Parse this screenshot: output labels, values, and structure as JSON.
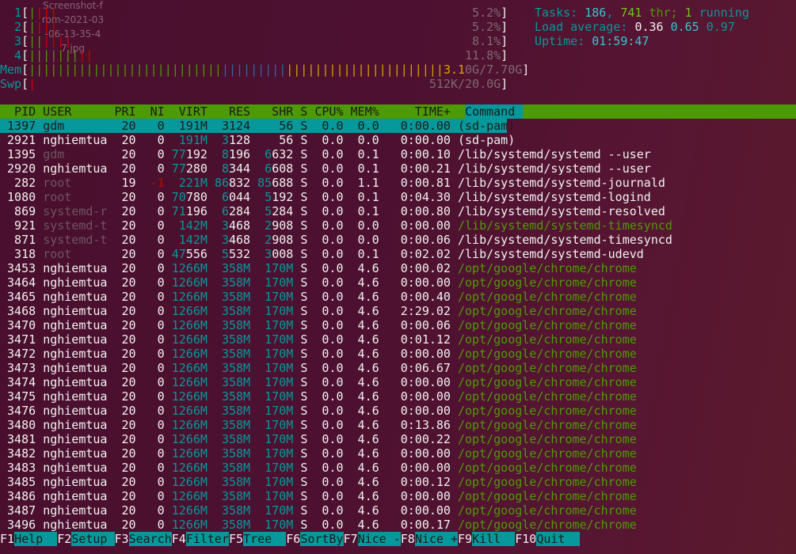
{
  "desktop_icon_label": "Screenshot-from-2021-03-06-13-35-47.jpg",
  "meters": {
    "cpus": [
      {
        "label": "1",
        "percent_text": "5.2%",
        "green_bars": 1,
        "red_bars": 3
      },
      {
        "label": "2",
        "percent_text": "5.2%",
        "green_bars": 1,
        "red_bars": 3
      },
      {
        "label": "3",
        "percent_text": "8.1%",
        "green_bars": 2,
        "red_bars": 4
      },
      {
        "label": "4",
        "percent_text": "11.8%",
        "green_bars": 7,
        "red_bars": 2
      }
    ],
    "mem": {
      "label": "Mem",
      "used_text": "3.1",
      "rest_text": "0G/7.70G",
      "used_bars": 27,
      "buffer_bars": 9,
      "cache_bars": 22
    },
    "swp": {
      "label": "Swp",
      "value_text": "512K/20.0G",
      "used_bars": 1
    }
  },
  "sysinfo": {
    "tasks_label": "Tasks: ",
    "tasks": "186",
    "threads": "741",
    "thr_label": " thr; ",
    "running": "1",
    "running_label": " running",
    "load_label": "Load average: ",
    "load1": "0.36",
    "load5": "0.65",
    "load15": "0.97",
    "uptime_label": "Uptime: ",
    "uptime": "01:59:47"
  },
  "columns": {
    "pid": "PID",
    "user": "USER",
    "pri": "PRI",
    "ni": "NI",
    "virt": "VIRT",
    "res": "RES",
    "shr": "SHR",
    "s": "S",
    "cpu": "CPU%",
    "mem": "MEM%",
    "time": "TIME+",
    "cmd": "Command"
  },
  "processes": [
    {
      "pid": "1397",
      "user": "gdm",
      "pri": "20",
      "ni": "0",
      "virt": "191M",
      "res": "3124",
      "shr": "56",
      "s": "S",
      "cpu": "0.0",
      "mem": "0.0",
      "time": "0:00.00",
      "cmd": "(sd-pam)",
      "selected": true,
      "user_dim": true,
      "thread": false
    },
    {
      "pid": "2921",
      "user": "nghiemtua",
      "pri": "20",
      "ni": "0",
      "virt": "191M",
      "res": "3128",
      "shr": "56",
      "s": "S",
      "cpu": "0.0",
      "mem": "0.0",
      "time": "0:00.00",
      "cmd": "(sd-pam)",
      "selected": false,
      "user_dim": false,
      "thread": false
    },
    {
      "pid": "1395",
      "user": "gdm",
      "pri": "20",
      "ni": "0",
      "virt": "77192",
      "res": "8196",
      "shr": "6632",
      "s": "S",
      "cpu": "0.0",
      "mem": "0.1",
      "time": "0:00.10",
      "cmd": "/lib/systemd/systemd --user",
      "selected": false,
      "user_dim": true,
      "thread": false
    },
    {
      "pid": "2920",
      "user": "nghiemtua",
      "pri": "20",
      "ni": "0",
      "virt": "77280",
      "res": "8344",
      "shr": "6608",
      "s": "S",
      "cpu": "0.0",
      "mem": "0.1",
      "time": "0:00.21",
      "cmd": "/lib/systemd/systemd --user",
      "selected": false,
      "user_dim": false,
      "thread": false
    },
    {
      "pid": "282",
      "user": "root",
      "pri": "19",
      "ni": "-1",
      "virt": "221M",
      "res": "86832",
      "shr": "85688",
      "s": "S",
      "cpu": "0.0",
      "mem": "1.1",
      "time": "0:00.81",
      "cmd": "/lib/systemd/systemd-journald",
      "selected": false,
      "user_dim": true,
      "thread": false
    },
    {
      "pid": "1080",
      "user": "root",
      "pri": "20",
      "ni": "0",
      "virt": "70780",
      "res": "6044",
      "shr": "5192",
      "s": "S",
      "cpu": "0.0",
      "mem": "0.1",
      "time": "0:04.30",
      "cmd": "/lib/systemd/systemd-logind",
      "selected": false,
      "user_dim": true,
      "thread": false
    },
    {
      "pid": "869",
      "user": "systemd-r",
      "pri": "20",
      "ni": "0",
      "virt": "71196",
      "res": "6284",
      "shr": "5284",
      "s": "S",
      "cpu": "0.0",
      "mem": "0.1",
      "time": "0:00.80",
      "cmd": "/lib/systemd/systemd-resolved",
      "selected": false,
      "user_dim": true,
      "thread": false
    },
    {
      "pid": "921",
      "user": "systemd-t",
      "pri": "20",
      "ni": "0",
      "virt": "142M",
      "res": "3468",
      "shr": "2908",
      "s": "S",
      "cpu": "0.0",
      "mem": "0.0",
      "time": "0:00.00",
      "cmd": "/lib/systemd/systemd-timesyncd",
      "selected": false,
      "user_dim": true,
      "thread": true
    },
    {
      "pid": "871",
      "user": "systemd-t",
      "pri": "20",
      "ni": "0",
      "virt": "142M",
      "res": "3468",
      "shr": "2908",
      "s": "S",
      "cpu": "0.0",
      "mem": "0.0",
      "time": "0:00.06",
      "cmd": "/lib/systemd/systemd-timesyncd",
      "selected": false,
      "user_dim": true,
      "thread": false
    },
    {
      "pid": "318",
      "user": "root",
      "pri": "20",
      "ni": "0",
      "virt": "47556",
      "res": "5532",
      "shr": "3008",
      "s": "S",
      "cpu": "0.0",
      "mem": "0.1",
      "time": "0:02.02",
      "cmd": "/lib/systemd/systemd-udevd",
      "selected": false,
      "user_dim": true,
      "thread": false
    },
    {
      "pid": "3453",
      "user": "nghiemtua",
      "pri": "20",
      "ni": "0",
      "virt": "1266M",
      "res": "358M",
      "shr": "170M",
      "s": "S",
      "cpu": "0.0",
      "mem": "4.6",
      "time": "0:00.02",
      "cmd": "/opt/google/chrome/chrome",
      "selected": false,
      "user_dim": false,
      "thread": true
    },
    {
      "pid": "3464",
      "user": "nghiemtua",
      "pri": "20",
      "ni": "0",
      "virt": "1266M",
      "res": "358M",
      "shr": "170M",
      "s": "S",
      "cpu": "0.0",
      "mem": "4.6",
      "time": "0:00.00",
      "cmd": "/opt/google/chrome/chrome",
      "selected": false,
      "user_dim": false,
      "thread": true
    },
    {
      "pid": "3465",
      "user": "nghiemtua",
      "pri": "20",
      "ni": "0",
      "virt": "1266M",
      "res": "358M",
      "shr": "170M",
      "s": "S",
      "cpu": "0.0",
      "mem": "4.6",
      "time": "0:00.40",
      "cmd": "/opt/google/chrome/chrome",
      "selected": false,
      "user_dim": false,
      "thread": true
    },
    {
      "pid": "3468",
      "user": "nghiemtua",
      "pri": "20",
      "ni": "0",
      "virt": "1266M",
      "res": "358M",
      "shr": "170M",
      "s": "S",
      "cpu": "0.0",
      "mem": "4.6",
      "time": "2:29.02",
      "cmd": "/opt/google/chrome/chrome",
      "selected": false,
      "user_dim": false,
      "thread": true
    },
    {
      "pid": "3470",
      "user": "nghiemtua",
      "pri": "20",
      "ni": "0",
      "virt": "1266M",
      "res": "358M",
      "shr": "170M",
      "s": "S",
      "cpu": "0.0",
      "mem": "4.6",
      "time": "0:00.06",
      "cmd": "/opt/google/chrome/chrome",
      "selected": false,
      "user_dim": false,
      "thread": true
    },
    {
      "pid": "3471",
      "user": "nghiemtua",
      "pri": "20",
      "ni": "0",
      "virt": "1266M",
      "res": "358M",
      "shr": "170M",
      "s": "S",
      "cpu": "0.0",
      "mem": "4.6",
      "time": "0:01.12",
      "cmd": "/opt/google/chrome/chrome",
      "selected": false,
      "user_dim": false,
      "thread": true
    },
    {
      "pid": "3472",
      "user": "nghiemtua",
      "pri": "20",
      "ni": "0",
      "virt": "1266M",
      "res": "358M",
      "shr": "170M",
      "s": "S",
      "cpu": "0.0",
      "mem": "4.6",
      "time": "0:00.00",
      "cmd": "/opt/google/chrome/chrome",
      "selected": false,
      "user_dim": false,
      "thread": true
    },
    {
      "pid": "3473",
      "user": "nghiemtua",
      "pri": "20",
      "ni": "0",
      "virt": "1266M",
      "res": "358M",
      "shr": "170M",
      "s": "S",
      "cpu": "0.0",
      "mem": "4.6",
      "time": "0:06.67",
      "cmd": "/opt/google/chrome/chrome",
      "selected": false,
      "user_dim": false,
      "thread": true
    },
    {
      "pid": "3474",
      "user": "nghiemtua",
      "pri": "20",
      "ni": "0",
      "virt": "1266M",
      "res": "358M",
      "shr": "170M",
      "s": "S",
      "cpu": "0.0",
      "mem": "4.6",
      "time": "0:00.00",
      "cmd": "/opt/google/chrome/chrome",
      "selected": false,
      "user_dim": false,
      "thread": true
    },
    {
      "pid": "3475",
      "user": "nghiemtua",
      "pri": "20",
      "ni": "0",
      "virt": "1266M",
      "res": "358M",
      "shr": "170M",
      "s": "S",
      "cpu": "0.0",
      "mem": "4.6",
      "time": "0:00.00",
      "cmd": "/opt/google/chrome/chrome",
      "selected": false,
      "user_dim": false,
      "thread": true
    },
    {
      "pid": "3476",
      "user": "nghiemtua",
      "pri": "20",
      "ni": "0",
      "virt": "1266M",
      "res": "358M",
      "shr": "170M",
      "s": "S",
      "cpu": "0.0",
      "mem": "4.6",
      "time": "0:00.00",
      "cmd": "/opt/google/chrome/chrome",
      "selected": false,
      "user_dim": false,
      "thread": true
    },
    {
      "pid": "3480",
      "user": "nghiemtua",
      "pri": "20",
      "ni": "0",
      "virt": "1266M",
      "res": "358M",
      "shr": "170M",
      "s": "S",
      "cpu": "0.0",
      "mem": "4.6",
      "time": "0:13.86",
      "cmd": "/opt/google/chrome/chrome",
      "selected": false,
      "user_dim": false,
      "thread": true
    },
    {
      "pid": "3481",
      "user": "nghiemtua",
      "pri": "20",
      "ni": "0",
      "virt": "1266M",
      "res": "358M",
      "shr": "170M",
      "s": "S",
      "cpu": "0.0",
      "mem": "4.6",
      "time": "0:00.22",
      "cmd": "/opt/google/chrome/chrome",
      "selected": false,
      "user_dim": false,
      "thread": true
    },
    {
      "pid": "3482",
      "user": "nghiemtua",
      "pri": "20",
      "ni": "0",
      "virt": "1266M",
      "res": "358M",
      "shr": "170M",
      "s": "S",
      "cpu": "0.0",
      "mem": "4.6",
      "time": "0:00.00",
      "cmd": "/opt/google/chrome/chrome",
      "selected": false,
      "user_dim": false,
      "thread": true
    },
    {
      "pid": "3483",
      "user": "nghiemtua",
      "pri": "20",
      "ni": "0",
      "virt": "1266M",
      "res": "358M",
      "shr": "170M",
      "s": "S",
      "cpu": "0.0",
      "mem": "4.6",
      "time": "0:00.00",
      "cmd": "/opt/google/chrome/chrome",
      "selected": false,
      "user_dim": false,
      "thread": true
    },
    {
      "pid": "3485",
      "user": "nghiemtua",
      "pri": "20",
      "ni": "0",
      "virt": "1266M",
      "res": "358M",
      "shr": "170M",
      "s": "S",
      "cpu": "0.0",
      "mem": "4.6",
      "time": "0:00.12",
      "cmd": "/opt/google/chrome/chrome",
      "selected": false,
      "user_dim": false,
      "thread": true
    },
    {
      "pid": "3486",
      "user": "nghiemtua",
      "pri": "20",
      "ni": "0",
      "virt": "1266M",
      "res": "358M",
      "shr": "170M",
      "s": "S",
      "cpu": "0.0",
      "mem": "4.6",
      "time": "0:00.00",
      "cmd": "/opt/google/chrome/chrome",
      "selected": false,
      "user_dim": false,
      "thread": true
    },
    {
      "pid": "3487",
      "user": "nghiemtua",
      "pri": "20",
      "ni": "0",
      "virt": "1266M",
      "res": "358M",
      "shr": "170M",
      "s": "S",
      "cpu": "0.0",
      "mem": "4.6",
      "time": "0:00.00",
      "cmd": "/opt/google/chrome/chrome",
      "selected": false,
      "user_dim": false,
      "thread": true
    },
    {
      "pid": "3496",
      "user": "nghiemtua",
      "pri": "20",
      "ni": "0",
      "virt": "1266M",
      "res": "358M",
      "shr": "170M",
      "s": "S",
      "cpu": "0.0",
      "mem": "4.6",
      "time": "0:00.17",
      "cmd": "/opt/google/chrome/chrome",
      "selected": false,
      "user_dim": false,
      "thread": true
    }
  ],
  "footer": [
    {
      "key": "F1",
      "label": "Help  "
    },
    {
      "key": "F2",
      "label": "Setup "
    },
    {
      "key": "F3",
      "label": "Search"
    },
    {
      "key": "F4",
      "label": "Filter"
    },
    {
      "key": "F5",
      "label": "Tree  "
    },
    {
      "key": "F6",
      "label": "SortBy"
    },
    {
      "key": "F7",
      "label": "Nice -"
    },
    {
      "key": "F8",
      "label": "Nice +"
    },
    {
      "key": "F9",
      "label": "Kill  "
    },
    {
      "key": "F10",
      "label": "Quit  "
    }
  ],
  "colors": {
    "header_bg": "#4e9a06",
    "selection_bg": "#06989a",
    "thread_cmd": "#4e9a06",
    "cpu_user": "#4e9a06",
    "cpu_kernel": "#cc0000",
    "mem_buffers": "#3465a4",
    "mem_cache": "#c4a000"
  }
}
